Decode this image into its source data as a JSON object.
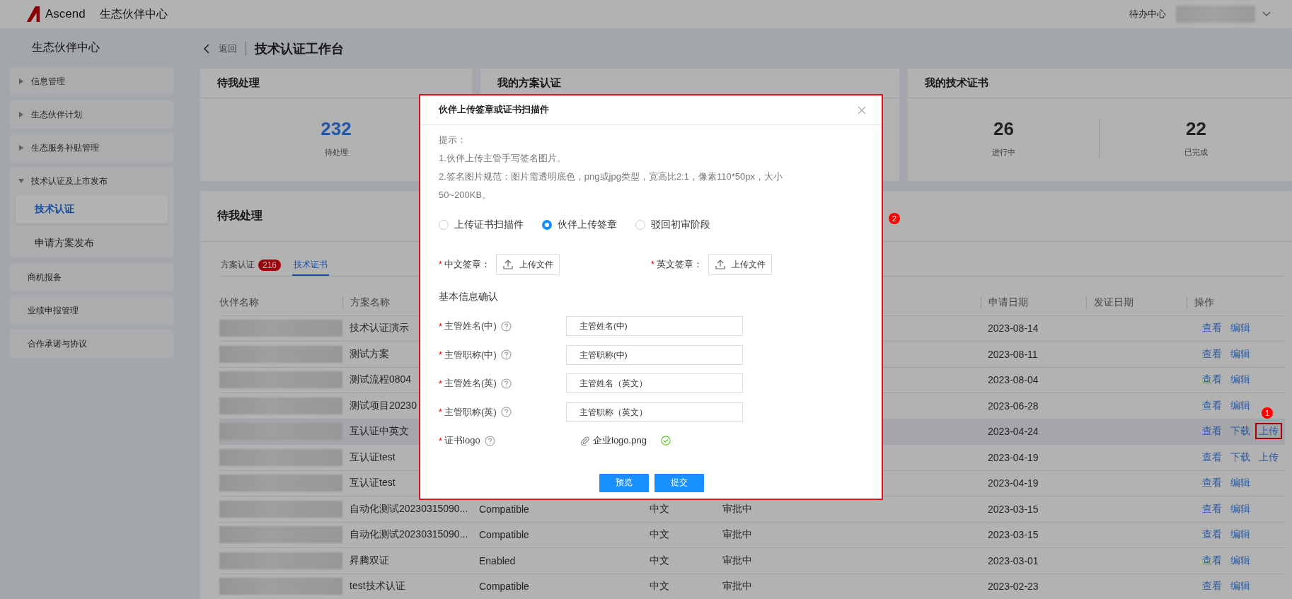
{
  "header": {
    "logo_text": "Ascend",
    "title": "生态伙伴中心",
    "todo": "待办中心"
  },
  "sidebar": {
    "title": "生态伙伴中心",
    "items": [
      {
        "kind": "group",
        "label": "信息管理",
        "expanded": false
      },
      {
        "kind": "group",
        "label": "生态伙伴计划",
        "expanded": false
      },
      {
        "kind": "group",
        "label": "生态服务补贴管理",
        "expanded": false
      },
      {
        "kind": "group",
        "label": "技术认证及上市发布",
        "expanded": true,
        "children": [
          {
            "label": "技术认证",
            "selected": true
          },
          {
            "label": "申请方案发布",
            "selected": false
          }
        ]
      },
      {
        "kind": "link",
        "label": "商机报备"
      },
      {
        "kind": "link",
        "label": "业绩申报管理"
      },
      {
        "kind": "link",
        "label": "合作承诺与协议"
      }
    ]
  },
  "page": {
    "back": "返回",
    "title": "技术认证工作台"
  },
  "summary_cards": [
    {
      "title": "待我处理",
      "stats": [
        {
          "value": "232",
          "label": "待处理",
          "highlighted": true
        }
      ]
    },
    {
      "title": "我的方案认证"
    },
    {
      "title": "我的技术证书",
      "stats": [
        {
          "value": "26",
          "label": "进行中",
          "highlighted": false
        },
        {
          "value": "22",
          "label": "已完成",
          "highlighted": false
        }
      ]
    }
  ],
  "pending": {
    "title": "待我处理",
    "tabs": [
      {
        "label": "方案认证",
        "badge": "216",
        "selected": false
      },
      {
        "label": "技术证书",
        "selected": true
      }
    ],
    "table": {
      "columns": {
        "partner": "伙伴名称",
        "scheme": "方案名称",
        "apply_date": "申请日期",
        "issue_date": "发证日期",
        "actions": "操作"
      },
      "rows": [
        {
          "scheme": "技术认证演示",
          "apply_date": "2023-08-14",
          "selected": false,
          "actions": [
            {
              "label": "查看"
            },
            {
              "label": "编辑"
            }
          ]
        },
        {
          "scheme": "测试方案",
          "apply_date": "2023-08-11",
          "selected": false,
          "actions": [
            {
              "label": "查看"
            },
            {
              "label": "编辑"
            }
          ]
        },
        {
          "scheme": "测试流程0804",
          "apply_date": "2023-08-04",
          "selected": false,
          "actions": [
            {
              "label": "查看"
            },
            {
              "label": "编辑"
            }
          ]
        },
        {
          "scheme": "测试项目20230",
          "apply_date": "2023-06-28",
          "selected": false,
          "actions": [
            {
              "label": "查看"
            },
            {
              "label": "编辑"
            }
          ]
        },
        {
          "scheme": "互认证中英文",
          "apply_date": "2023-04-24",
          "selected": true,
          "actions": [
            {
              "label": "查看"
            },
            {
              "label": "下载"
            },
            {
              "label": "上传",
              "marker": "1"
            }
          ]
        },
        {
          "scheme": "互认证test",
          "apply_date": "2023-04-19",
          "selected": false,
          "actions": [
            {
              "label": "查看"
            },
            {
              "label": "下载"
            },
            {
              "label": "上传"
            }
          ]
        },
        {
          "scheme": "互认证test",
          "apply_date": "2023-04-19",
          "selected": false,
          "actions": [
            {
              "label": "查看"
            },
            {
              "label": "编辑"
            }
          ]
        },
        {
          "scheme": "自动化测试20230315090...",
          "column_3": "Compatible",
          "column_4": "中文",
          "column_5": "审批中",
          "apply_date": "2023-03-15",
          "selected": false,
          "actions": [
            {
              "label": "查看"
            },
            {
              "label": "编辑"
            }
          ]
        },
        {
          "scheme": "自动化测试20230315090...",
          "column_3": "Compatible",
          "column_4": "中文",
          "column_5": "审批中",
          "apply_date": "2023-03-15",
          "selected": false,
          "actions": [
            {
              "label": "查看"
            },
            {
              "label": "编辑"
            }
          ]
        },
        {
          "scheme": "昇腾双证",
          "column_3": "Enabled",
          "column_4": "中文",
          "column_5": "审批中",
          "apply_date": "2023-03-01",
          "selected": false,
          "actions": [
            {
              "label": "查看"
            },
            {
              "label": "编辑"
            }
          ]
        },
        {
          "scheme": "test技术认证",
          "column_3": "Compatible",
          "column_4": "中文",
          "column_5": "审批中",
          "apply_date": "2023-02-23",
          "selected": false,
          "actions": [
            {
              "label": "查看"
            },
            {
              "label": "编辑"
            }
          ]
        }
      ]
    }
  },
  "dialog": {
    "title": "伙伴上传签章或证书扫描件",
    "marker": "2",
    "notes": [
      "提示：",
      "1.伙伴上传主管手写签名图片。",
      "2.签名图片规范：图片需透明底色，png或jpg类型，宽高比2:1，像素110*50px，大小50~200KB。"
    ],
    "radios": [
      {
        "label": "上传证书扫描件",
        "selected": false
      },
      {
        "label": "伙伴上传签章",
        "selected": true
      },
      {
        "label": "驳回初审阶段",
        "selected": false
      }
    ],
    "uploads": [
      {
        "mark": "*",
        "label": "中文签章：",
        "button": "上传文件"
      },
      {
        "mark": "*",
        "label": "英文签章：",
        "button": "上传文件"
      }
    ],
    "section": "基本信息确认",
    "fields": [
      {
        "mark": "*",
        "label": "主管姓名(中)",
        "placeholder": "主管姓名(中)"
      },
      {
        "mark": "*",
        "label": "主管职称(中)",
        "placeholder": "主管职称(中)"
      },
      {
        "mark": "*",
        "label": "主管姓名(英)",
        "placeholder": "主管姓名（英文）"
      },
      {
        "mark": "*",
        "label": "主管职称(英)",
        "placeholder": "主管职称（英文）"
      }
    ],
    "logo": {
      "mark": "*",
      "label": "证书logo",
      "file": "企业logo.png",
      "uploaded": true
    },
    "buttons": [
      "预览",
      "提交"
    ]
  }
}
